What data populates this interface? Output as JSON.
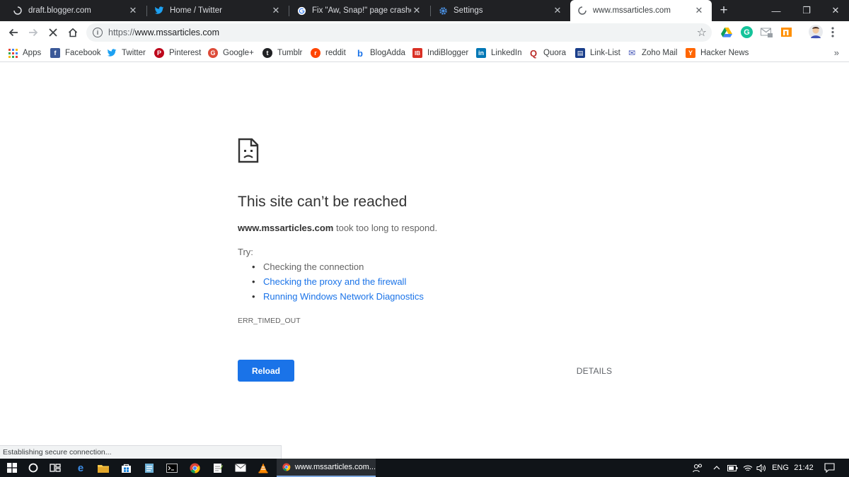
{
  "tabs": [
    {
      "title": "draft.blogger.com",
      "icon": "loading-spinner-icon"
    },
    {
      "title": "Home / Twitter",
      "icon": "twitter-bird-icon"
    },
    {
      "title": "Fix \"Aw, Snap!\" page crashes a",
      "icon": "google-g-icon"
    },
    {
      "title": "Settings",
      "icon": "gear-icon"
    },
    {
      "title": "www.mssarticles.com",
      "icon": "loading-spinner-icon",
      "active": true
    }
  ],
  "tab_close_glyph": "✕",
  "new_tab_glyph": "+",
  "window_controls": {
    "minimize": "—",
    "restore": "❐",
    "close": "✕"
  },
  "toolbar": {
    "url_scheme": "https://",
    "url_host": "www.mssarticles.com",
    "bookmark_star": "☆",
    "info_glyph": "i",
    "extensions": [
      "drive-icon",
      "grammarly-icon",
      "gmail-checker-icon",
      "ms-extension-icon",
      "profile-avatar-icon",
      "menu-icon"
    ]
  },
  "bookmarks": [
    {
      "label": "Apps",
      "icon": "apps-grid-icon"
    },
    {
      "label": "Facebook",
      "icon": "facebook-icon",
      "color": "#3b5998",
      "glyph": "f"
    },
    {
      "label": "Twitter",
      "icon": "twitter-icon",
      "color": "#1da1f2"
    },
    {
      "label": "Pinterest",
      "icon": "pinterest-icon",
      "color": "#bd081c",
      "glyph": "P"
    },
    {
      "label": "Google+",
      "icon": "google-plus-icon",
      "color": "#dd4b39",
      "glyph": "G"
    },
    {
      "label": "Tumblr",
      "icon": "tumblr-icon",
      "color": "#202124",
      "glyph": "t"
    },
    {
      "label": "reddit",
      "icon": "reddit-icon",
      "color": "#ff4500",
      "glyph": "r"
    },
    {
      "label": "BlogAdda",
      "icon": "blogadda-icon",
      "color": "#1a73e8",
      "glyph": "b"
    },
    {
      "label": "IndiBlogger",
      "icon": "indiblogger-icon",
      "color": "#d93025",
      "glyph": "IB"
    },
    {
      "label": "LinkedIn",
      "icon": "linkedin-icon",
      "color": "#0077b5",
      "glyph": "in"
    },
    {
      "label": "Quora",
      "icon": "quora-icon",
      "color": "#b92b27",
      "glyph": "Q"
    },
    {
      "label": "Link-List",
      "icon": "link-list-icon",
      "color": "#1a3e8a",
      "glyph": "▤"
    },
    {
      "label": "Zoho Mail",
      "icon": "zoho-mail-icon",
      "color": "#3f51b5",
      "glyph": "✉"
    },
    {
      "label": "Hacker News",
      "icon": "hacker-news-icon",
      "color": "#ff6600",
      "glyph": "Y"
    }
  ],
  "bookmarks_overflow": "»",
  "error": {
    "title": "This site can’t be reached",
    "host": "www.mssarticles.com",
    "summary_rest": " took too long to respond.",
    "try_label": "Try:",
    "suggestions": [
      {
        "text": "Checking the connection",
        "link": false
      },
      {
        "text": "Checking the proxy and the firewall",
        "link": true
      },
      {
        "text": "Running Windows Network Diagnostics",
        "link": true
      }
    ],
    "code": "ERR_TIMED_OUT",
    "reload_label": "Reload",
    "details_label": "DETAILS"
  },
  "status_bubble": "Establishing secure connection...",
  "taskbar": {
    "active_app_label": "www.mssarticles.com...",
    "language": "ENG",
    "time": "21:42"
  },
  "colors": {
    "accent": "#1a73e8",
    "tabstrip": "#202124",
    "taskbar": "#101418"
  }
}
